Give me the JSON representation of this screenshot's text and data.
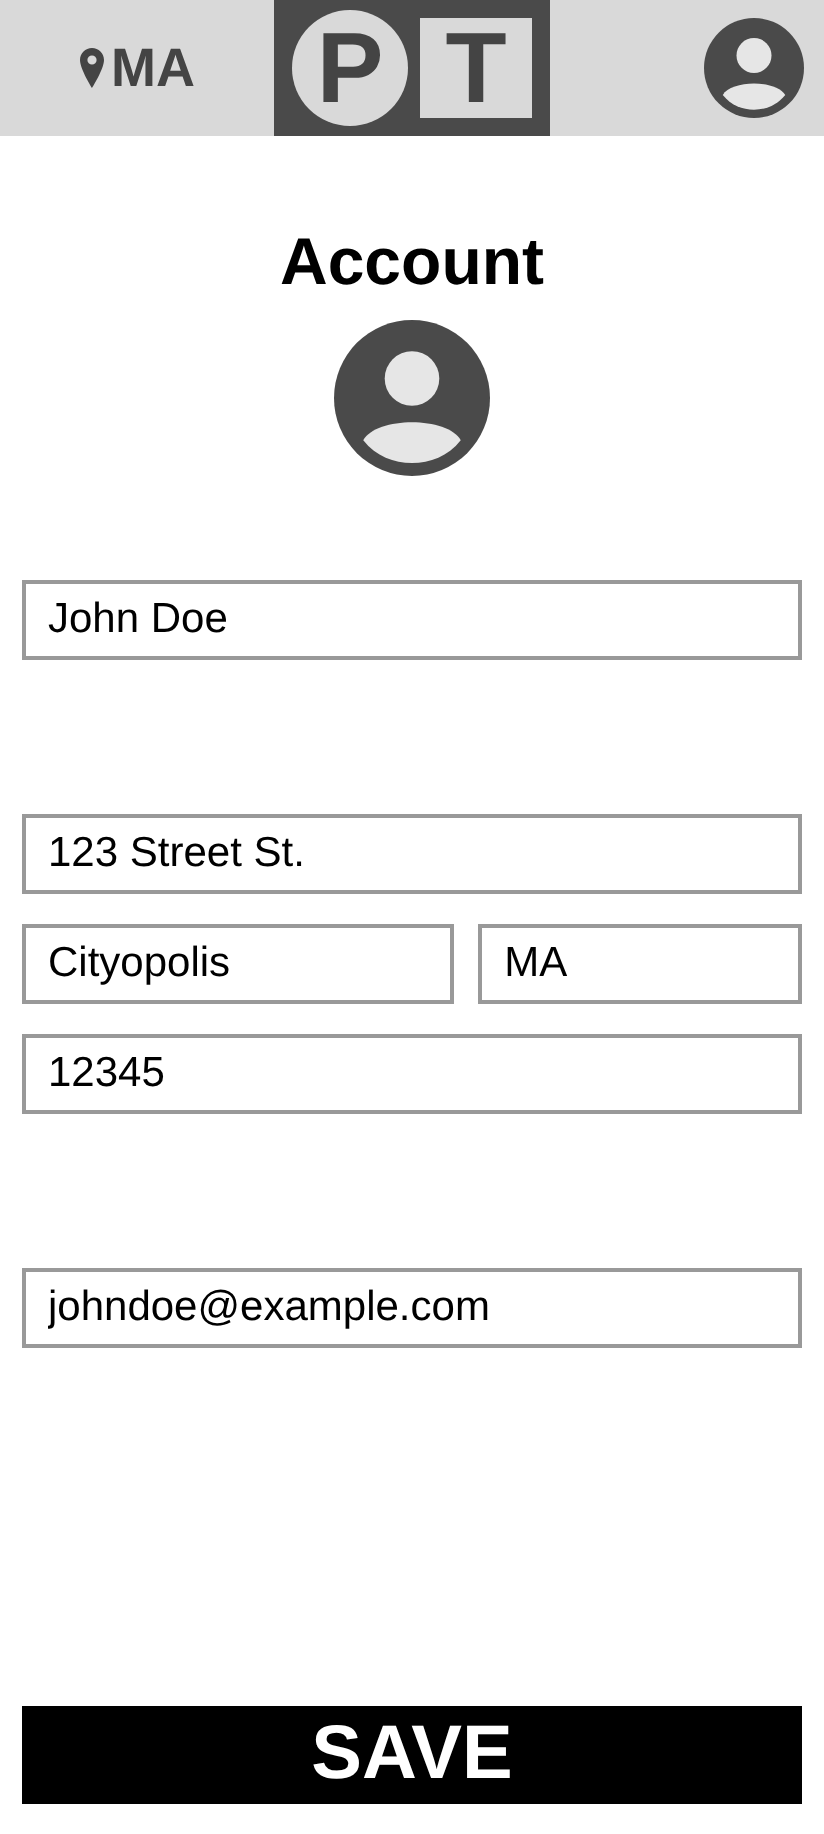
{
  "header": {
    "location": "MA",
    "logo": [
      "P",
      "T"
    ]
  },
  "title": "Account",
  "groups": [
    {
      "rows": [
        [
          {
            "value": "John Doe"
          }
        ]
      ]
    },
    {
      "rows": [
        [
          {
            "value": "123 Street St."
          }
        ],
        [
          {
            "value": "Cityopolis"
          },
          {
            "value": "MA"
          }
        ],
        [
          {
            "value": "12345"
          }
        ]
      ]
    },
    {
      "rows": [
        [
          {
            "value": "johndoe@example.com"
          }
        ]
      ]
    }
  ],
  "save_button": "SAVE"
}
